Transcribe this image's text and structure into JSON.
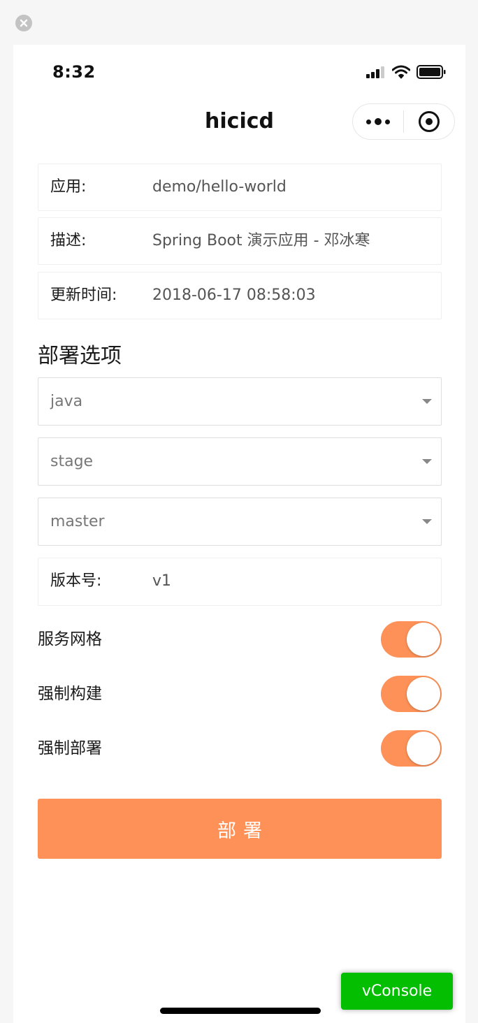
{
  "status_bar": {
    "time": "8:32"
  },
  "nav": {
    "title": "hicicd"
  },
  "app_info": {
    "items": [
      {
        "label": "应用:",
        "value": "demo/hello-world"
      },
      {
        "label": "描述:",
        "value": "Spring Boot 演示应用 - 邓冰寒"
      },
      {
        "label": "更新时间:",
        "value": "2018-06-17 08:58:03"
      }
    ]
  },
  "deploy_options": {
    "title": "部署选项",
    "selects": [
      {
        "value": "java"
      },
      {
        "value": "stage"
      },
      {
        "value": "master"
      }
    ],
    "version": {
      "label": "版本号:",
      "value": "v1"
    },
    "toggles": [
      {
        "label": "服务网格",
        "on": true
      },
      {
        "label": "强制构建",
        "on": true
      },
      {
        "label": "强制部署",
        "on": true
      }
    ]
  },
  "deploy_button": {
    "label": "部署"
  },
  "vconsole": {
    "label": "vConsole"
  },
  "colors": {
    "accent": "#fd9157",
    "vconsole_green": "#04be02"
  },
  "icons": [
    "close-icon",
    "signal-icon",
    "wifi-icon",
    "battery-icon",
    "more-dots-icon",
    "target-icon",
    "dropdown-caret-icon"
  ]
}
